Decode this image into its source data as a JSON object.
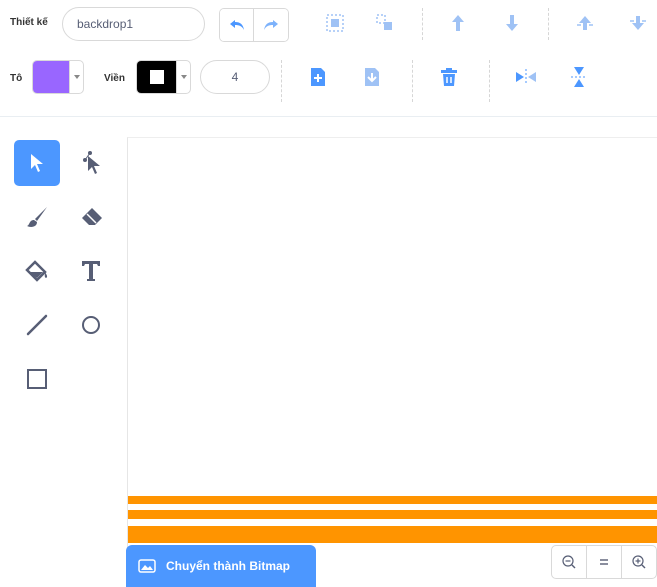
{
  "toolbar": {
    "costume_label": "Thiết kế",
    "costume_name": "backdrop1",
    "fill_label": "Tô",
    "outline_label": "Viền",
    "outline_width": "4",
    "fill_color": "#9966ff",
    "outline_color": "#000000",
    "icons": {
      "undo": "undo-icon",
      "redo": "redo-icon",
      "group": "group-icon",
      "ungroup": "ungroup-icon",
      "forward": "forward-icon",
      "backward": "backward-icon",
      "front": "front-icon",
      "back": "back-icon",
      "copy": "copy-icon",
      "paste": "paste-icon",
      "delete": "delete-icon",
      "flip_h": "flip-horizontal-icon",
      "flip_v": "flip-vertical-icon"
    }
  },
  "tools": [
    "select",
    "reshape",
    "brush",
    "eraser",
    "fill",
    "text",
    "line",
    "circle",
    "rectangle"
  ],
  "footer": {
    "convert_label": "Chuyển thành Bitmap",
    "zoom_buttons": [
      "zoom-out",
      "zoom-reset",
      "zoom-in"
    ]
  },
  "colors": {
    "accent": "#4c97ff",
    "stripe": "#ff9400",
    "fill": "#9966ff"
  }
}
